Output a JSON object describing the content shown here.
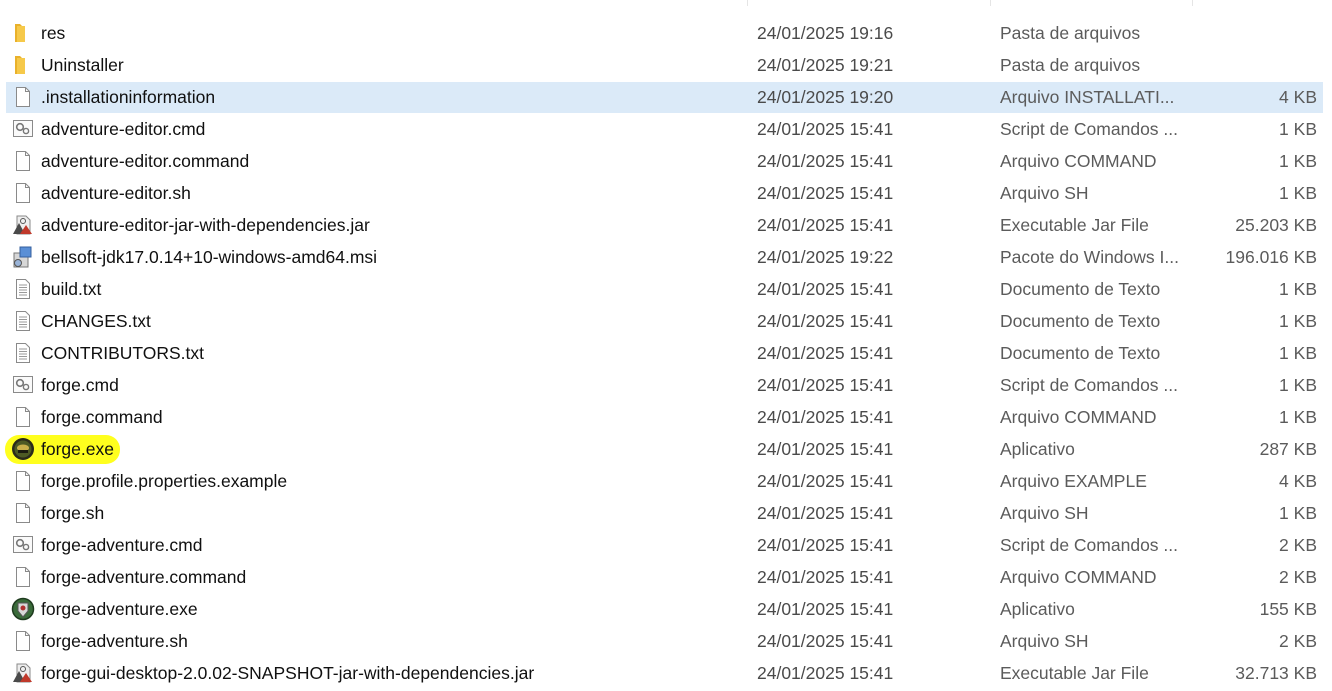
{
  "colors": {
    "selected_row": "#dbeaf8",
    "highlight": "#ffff1e",
    "folder": "#f3c13a"
  },
  "files": [
    {
      "name": "res",
      "date": "24/01/2025 19:16",
      "type": "Pasta de arquivos",
      "size": "",
      "icon": "folder-icon"
    },
    {
      "name": "Uninstaller",
      "date": "24/01/2025 19:21",
      "type": "Pasta de arquivos",
      "size": "",
      "icon": "folder-icon"
    },
    {
      "name": ".installationinformation",
      "date": "24/01/2025 19:20",
      "type": "Arquivo INSTALLATI...",
      "size": "4 KB",
      "icon": "file-icon",
      "selected": true
    },
    {
      "name": "adventure-editor.cmd",
      "date": "24/01/2025 15:41",
      "type": "Script de Comandos ...",
      "size": "1 KB",
      "icon": "cmd-script-icon"
    },
    {
      "name": "adventure-editor.command",
      "date": "24/01/2025 15:41",
      "type": "Arquivo COMMAND",
      "size": "1 KB",
      "icon": "file-icon"
    },
    {
      "name": "adventure-editor.sh",
      "date": "24/01/2025 15:41",
      "type": "Arquivo SH",
      "size": "1 KB",
      "icon": "file-icon"
    },
    {
      "name": "adventure-editor-jar-with-dependencies.jar",
      "date": "24/01/2025 15:41",
      "type": "Executable Jar File",
      "size": "25.203 KB",
      "icon": "jar-icon"
    },
    {
      "name": "bellsoft-jdk17.0.14+10-windows-amd64.msi",
      "date": "24/01/2025 19:22",
      "type": "Pacote do Windows I...",
      "size": "196.016 KB",
      "icon": "msi-package-icon"
    },
    {
      "name": "build.txt",
      "date": "24/01/2025 15:41",
      "type": "Documento de Texto",
      "size": "1 KB",
      "icon": "text-file-icon"
    },
    {
      "name": "CHANGES.txt",
      "date": "24/01/2025 15:41",
      "type": "Documento de Texto",
      "size": "1 KB",
      "icon": "text-file-icon"
    },
    {
      "name": "CONTRIBUTORS.txt",
      "date": "24/01/2025 15:41",
      "type": "Documento de Texto",
      "size": "1 KB",
      "icon": "text-file-icon"
    },
    {
      "name": "forge.cmd",
      "date": "24/01/2025 15:41",
      "type": "Script de Comandos ...",
      "size": "1 KB",
      "icon": "cmd-script-icon"
    },
    {
      "name": "forge.command",
      "date": "24/01/2025 15:41",
      "type": "Arquivo COMMAND",
      "size": "1 KB",
      "icon": "file-icon"
    },
    {
      "name": "forge.exe",
      "date": "24/01/2025 15:41",
      "type": "Aplicativo",
      "size": "287 KB",
      "icon": "forge-app-icon",
      "highlighted": true
    },
    {
      "name": "forge.profile.properties.example",
      "date": "24/01/2025 15:41",
      "type": "Arquivo EXAMPLE",
      "size": "4 KB",
      "icon": "file-icon"
    },
    {
      "name": "forge.sh",
      "date": "24/01/2025 15:41",
      "type": "Arquivo SH",
      "size": "1 KB",
      "icon": "file-icon"
    },
    {
      "name": "forge-adventure.cmd",
      "date": "24/01/2025 15:41",
      "type": "Script de Comandos ...",
      "size": "2 KB",
      "icon": "cmd-script-icon"
    },
    {
      "name": "forge-adventure.command",
      "date": "24/01/2025 15:41",
      "type": "Arquivo COMMAND",
      "size": "2 KB",
      "icon": "file-icon"
    },
    {
      "name": "forge-adventure.exe",
      "date": "24/01/2025 15:41",
      "type": "Aplicativo",
      "size": "155 KB",
      "icon": "forge-adventure-app-icon"
    },
    {
      "name": "forge-adventure.sh",
      "date": "24/01/2025 15:41",
      "type": "Arquivo SH",
      "size": "2 KB",
      "icon": "file-icon"
    },
    {
      "name": "forge-gui-desktop-2.0.02-SNAPSHOT-jar-with-dependencies.jar",
      "date": "24/01/2025 15:41",
      "type": "Executable Jar File",
      "size": "32.713 KB",
      "icon": "jar-icon"
    }
  ]
}
